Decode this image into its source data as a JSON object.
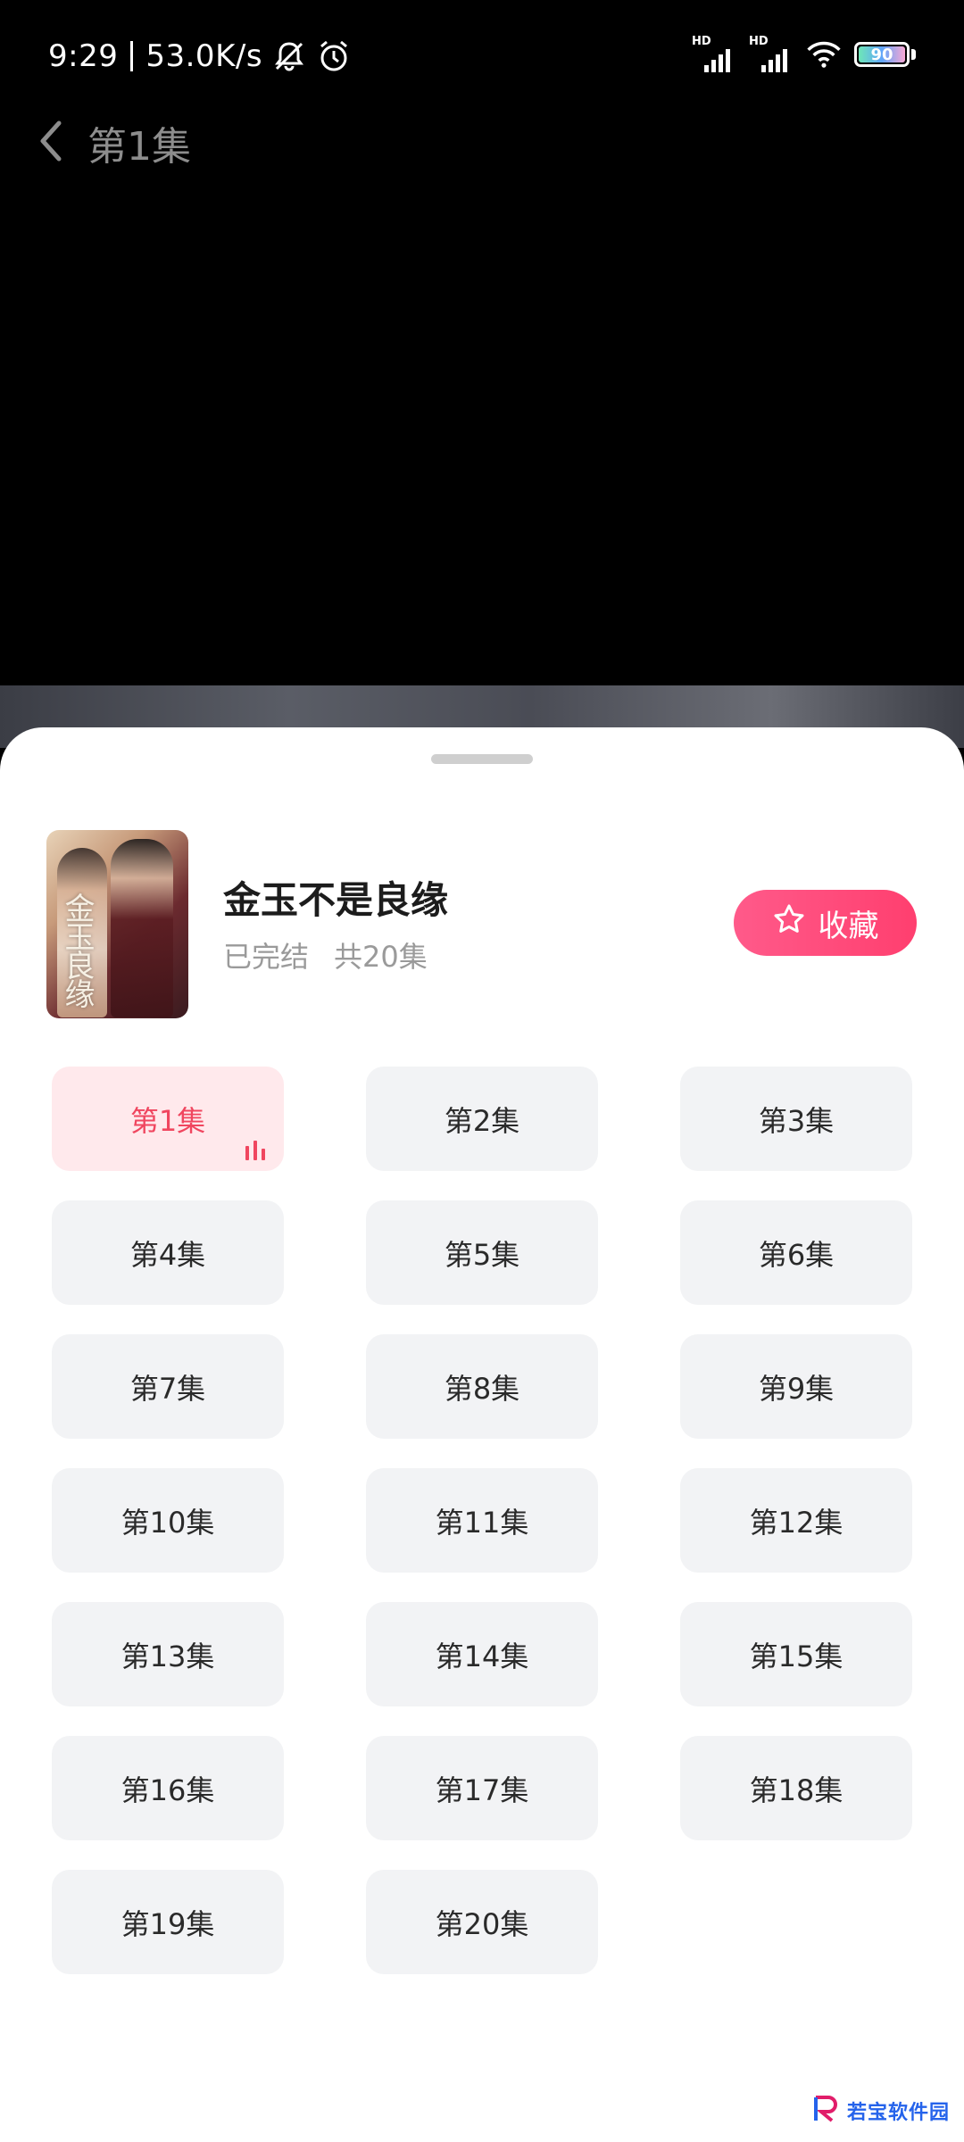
{
  "status_bar": {
    "time": "9:29",
    "speed": "53.0K/s",
    "battery": "90",
    "signal_label": "HD",
    "icons": [
      "bell-off-icon",
      "alarm-icon",
      "signal-icon",
      "wifi-icon",
      "battery-icon"
    ]
  },
  "video": {
    "title": "第1集",
    "back_icon": "chevron-left-icon"
  },
  "drama": {
    "title": "金玉不是良缘",
    "status": "已完结",
    "count": "共20集",
    "poster_text": "金玉良缘",
    "favorite_label": "收藏"
  },
  "episodes": [
    "第1集",
    "第2集",
    "第3集",
    "第4集",
    "第5集",
    "第6集",
    "第7集",
    "第8集",
    "第9集",
    "第10集",
    "第11集",
    "第12集",
    "第13集",
    "第14集",
    "第15集",
    "第16集",
    "第17集",
    "第18集",
    "第19集",
    "第20集"
  ],
  "active_episode": 0,
  "colors": {
    "accent": "#ff3f6f",
    "active_bg": "#ffe9ec",
    "active_text": "#f0465f",
    "tile_bg": "#f2f3f5"
  },
  "watermark": "若宝软件园"
}
